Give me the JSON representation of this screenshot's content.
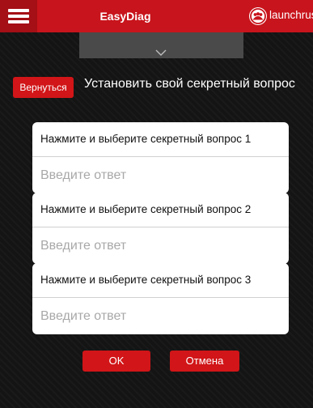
{
  "header": {
    "title": "EasyDiag",
    "brand_label": "launchrus",
    "menu_icon": "hamburger-menu-icon",
    "brand_icon": "people-group-icon",
    "bar_color": "#c8141c"
  },
  "back_button": {
    "label": "Вернуться"
  },
  "page": {
    "title": "Установить свой секретный вопрос"
  },
  "questions": [
    {
      "label": "Нажмите и выберите секретный вопрос 1",
      "placeholder": "Введите ответ"
    },
    {
      "label": "Нажмите и выберите секретный вопрос 2",
      "placeholder": "Введите ответ"
    },
    {
      "label": "Нажмите и выберите секретный вопрос 3",
      "placeholder": "Введите ответ"
    }
  ],
  "actions": {
    "ok_label": "OK",
    "cancel_label": "Отмена"
  }
}
